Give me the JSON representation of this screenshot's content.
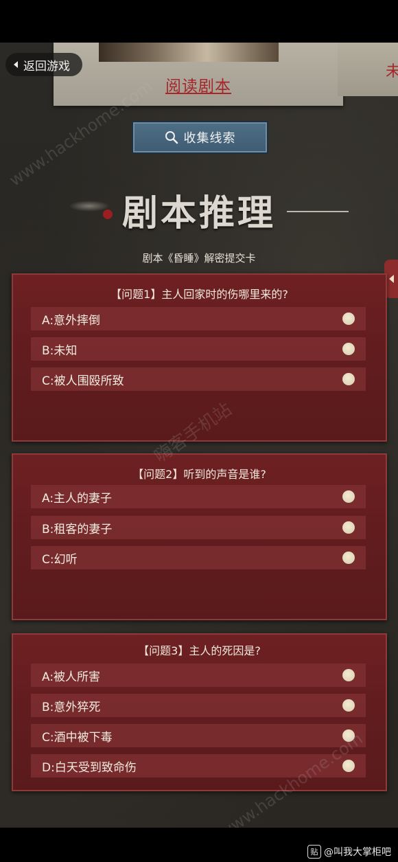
{
  "read_script_label": "阅读剧本",
  "right_card_char": "未",
  "back_button": {
    "label": "返回游戏"
  },
  "collect_button": {
    "label": "收集线索"
  },
  "section": {
    "title": "剧本推理",
    "subtitle": "剧本《昏睡》解密提交卡"
  },
  "questions": [
    {
      "title": "【问题1】主人回家时的伤哪里来的?",
      "options": [
        "A:意外摔倒",
        "B:未知",
        "C:被人围殴所致"
      ]
    },
    {
      "title": "【问题2】听到的声音是谁?",
      "options": [
        "A:主人的妻子",
        "B:租客的妻子",
        "C:幻听"
      ]
    },
    {
      "title": "【问题3】主人的死因是?",
      "options": [
        "A:被人所害",
        "B:意外猝死",
        "C:酒中被下毒",
        "D:白天受到致命伤"
      ]
    }
  ],
  "watermark": {
    "top": "www.hackhome.com",
    "mid": "嗨客手机站",
    "bottom": "www.hackhome.com"
  },
  "footer": {
    "icon_text": "贴",
    "label": "@叫我大掌柜吧"
  },
  "colors": {
    "card": "#6e2022",
    "accent_red": "#a6262a",
    "button_blue": "#4f6f87"
  }
}
